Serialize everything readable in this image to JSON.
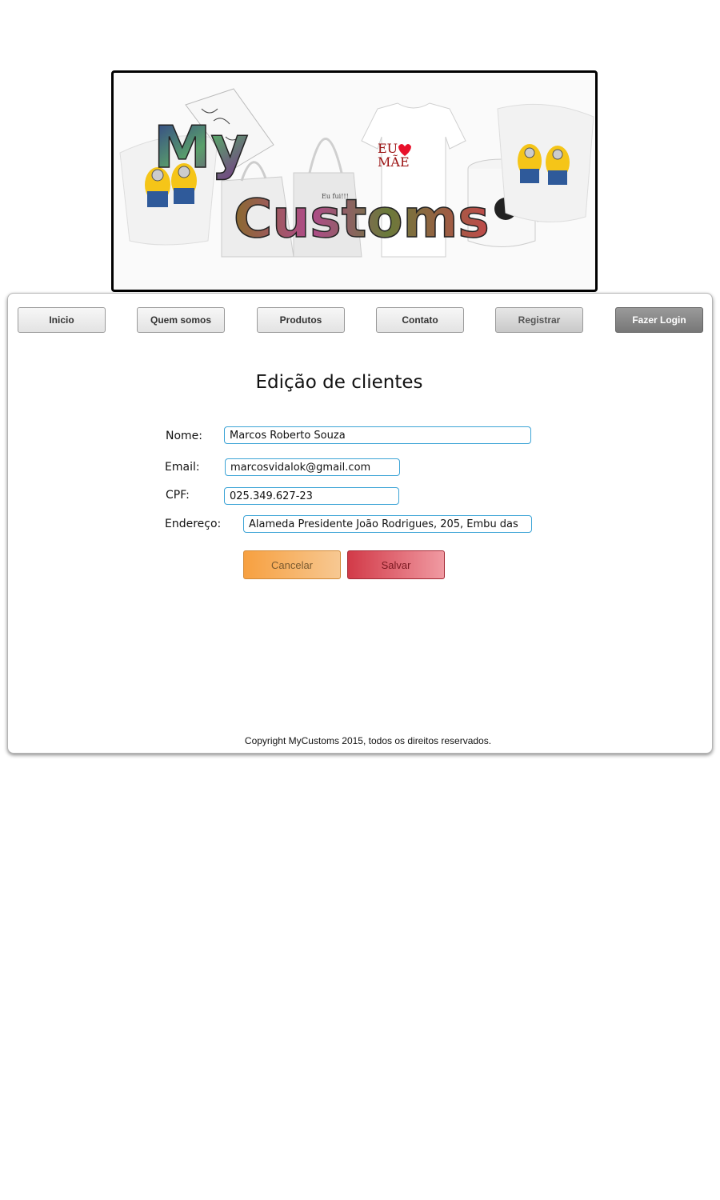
{
  "banner": {
    "logo_word1": "My",
    "logo_word2": "Customs",
    "tshirt_text_line1": "EU",
    "tshirt_text_line2": "MÃE",
    "bag_text": "Eu fui!!!"
  },
  "nav": {
    "items": [
      {
        "label": "Inicio"
      },
      {
        "label": "Quem somos"
      },
      {
        "label": "Produtos"
      },
      {
        "label": "Contato"
      },
      {
        "label": "Registrar"
      },
      {
        "label": "Fazer Login"
      }
    ]
  },
  "main": {
    "title": "Edição de clientes",
    "form": {
      "name_label": "Nome:",
      "name_value": "Marcos Roberto Souza",
      "email_label": "Email:",
      "email_value": "marcosvidalok@gmail.com",
      "cpf_label": "CPF:",
      "cpf_value": "025.349.627-23",
      "address_label": "Endereço:",
      "address_value": "Alameda Presidente João Rodrigues, 205, Embu das"
    },
    "buttons": {
      "cancel_label": "Cancelar",
      "save_label": "Salvar"
    }
  },
  "footer": {
    "copyright": "Copyright MyCustoms 2015, todos os direitos reservados."
  },
  "colors": {
    "input_border": "#3ba3d6",
    "cancel_button": "#f7a040",
    "save_button": "#d23a48",
    "heart": "#e8102a"
  }
}
